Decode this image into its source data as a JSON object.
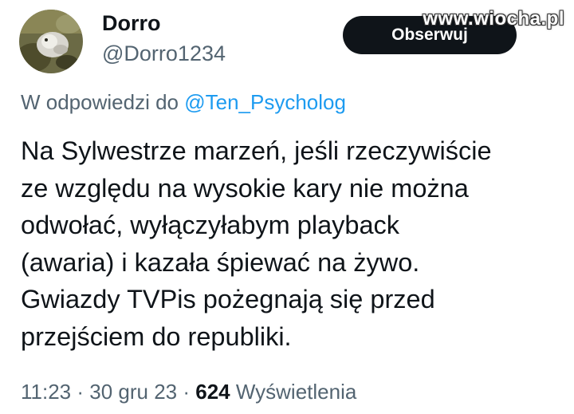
{
  "user": {
    "display_name": "Dorro",
    "handle": "@Dorro1234"
  },
  "follow_button": {
    "label": "Obserwuj"
  },
  "watermark": "www.wiocha.pl",
  "reply": {
    "prefix": "W odpowiedzi do ",
    "mention": "@Ten_Psycholog"
  },
  "tweet": {
    "lines": [
      "Na Sylwestrze marzeń, jeśli rzeczywiście",
      "ze względu na wysokie kary nie można",
      "odwołać, wyłączyłabym playback",
      "(awaria) i kazała śpiewać na żywo.",
      "Gwiazdy TVPis pożegnają się przed",
      "przejściem do republiki."
    ]
  },
  "meta": {
    "time": "11:23",
    "separator": " · ",
    "date": "30 gru 23",
    "views_count": "624",
    "views_label": " Wyświetlenia"
  },
  "colors": {
    "text": "#0f1419",
    "secondary": "#536471",
    "link": "#1d9bf0",
    "button_bg": "#0f1419"
  }
}
